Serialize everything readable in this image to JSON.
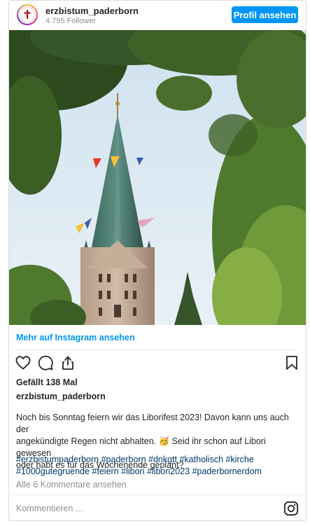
{
  "header": {
    "username": "erzbistum_paderborn",
    "followers": "4.795 Follower",
    "profile_button": "Profil ansehen",
    "avatar_icon": "cross-logo-icon"
  },
  "post": {
    "more_on_instagram": "Mehr auf Instagram ansehen",
    "likes": "Gefällt 138 Mal",
    "author": "erzbistum_paderborn",
    "caption_lines": [
      "Noch bis Sonntag feiern wir das Liborifest 2023! Davon kann uns auch der",
      "angekündigte Regen nicht abhalten. 🥳 Seid ihr schon auf Libori gewesen",
      "oder habt es für das Wochenende geplant?"
    ],
    "hashtag_lines": [
      "#erzbistumpaderborn #paderborn #dnkgtt #katholisch #kirche",
      "#1000gutegruende #feiern #libori #libori2023 #paderbornerdom"
    ],
    "view_comments": "Alle 6 Kommentare ansehen",
    "comment_placeholder": "Kommentieren ..."
  },
  "icons": {
    "like": "heart-icon",
    "comment": "comment-bubble-icon",
    "share": "share-icon",
    "save": "bookmark-icon",
    "instagram": "instagram-logo-icon"
  },
  "colors": {
    "accent": "#0095f6",
    "hashtag": "#00376b",
    "muted": "#8e8e8e"
  }
}
